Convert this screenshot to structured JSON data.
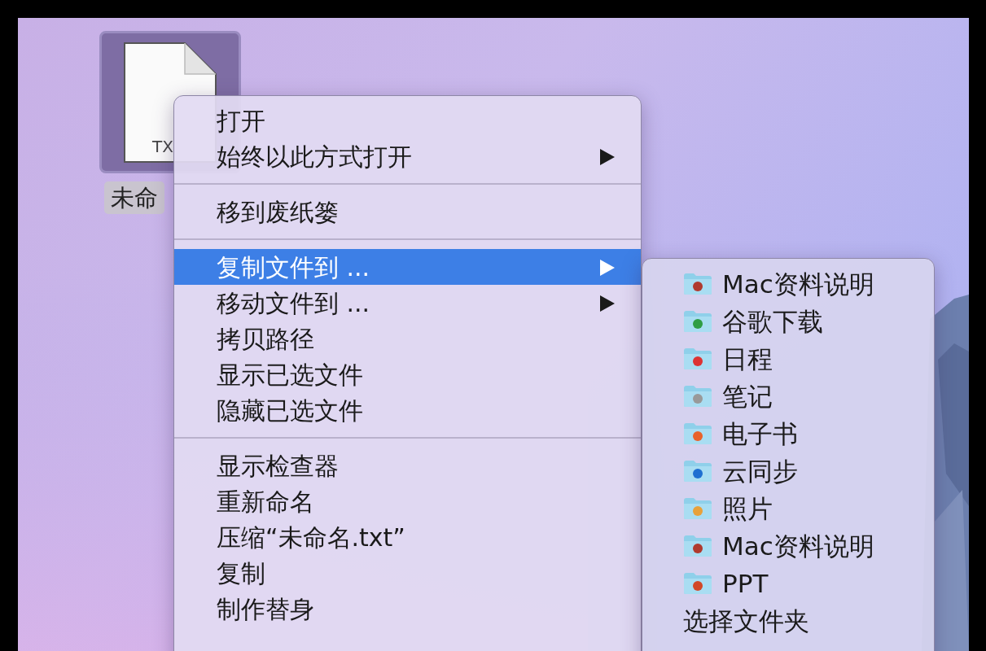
{
  "desktop_icon": {
    "type_label": "TX",
    "name": "未命",
    "selected": true
  },
  "context_menu": {
    "groups": [
      [
        {
          "label": "打开",
          "submenu": false,
          "selected": false
        },
        {
          "label": "始终以此方式打开",
          "submenu": true,
          "selected": false
        }
      ],
      [
        {
          "label": "移到废纸篓",
          "submenu": false,
          "selected": false
        }
      ],
      [
        {
          "label": "复制文件到 ...",
          "submenu": true,
          "selected": true
        },
        {
          "label": "移动文件到 ...",
          "submenu": true,
          "selected": false
        },
        {
          "label": "拷贝路径",
          "submenu": false,
          "selected": false
        },
        {
          "label": "显示已选文件",
          "submenu": false,
          "selected": false
        },
        {
          "label": "隐藏已选文件",
          "submenu": false,
          "selected": false
        }
      ],
      [
        {
          "label": "显示检查器",
          "submenu": false,
          "selected": false
        },
        {
          "label": "重新命名",
          "submenu": false,
          "selected": false
        },
        {
          "label": "压缩“未命名.txt”",
          "submenu": false,
          "selected": false
        },
        {
          "label": "复制",
          "submenu": false,
          "selected": false
        },
        {
          "label": "制作替身",
          "submenu": false,
          "selected": false
        }
      ]
    ]
  },
  "submenu": {
    "items": [
      {
        "label": "Mac资料说明",
        "kind": "folder"
      },
      {
        "label": "谷歌下载",
        "kind": "folder"
      },
      {
        "label": "日程",
        "kind": "folder"
      },
      {
        "label": "笔记",
        "kind": "folder"
      },
      {
        "label": "电子书",
        "kind": "folder"
      },
      {
        "label": "云同步",
        "kind": "folder"
      },
      {
        "label": "照片",
        "kind": "folder"
      },
      {
        "label": "Mac资料说明",
        "kind": "folder"
      },
      {
        "label": "PPT",
        "kind": "folder"
      },
      {
        "label": "选择文件夹",
        "kind": "command"
      }
    ]
  }
}
